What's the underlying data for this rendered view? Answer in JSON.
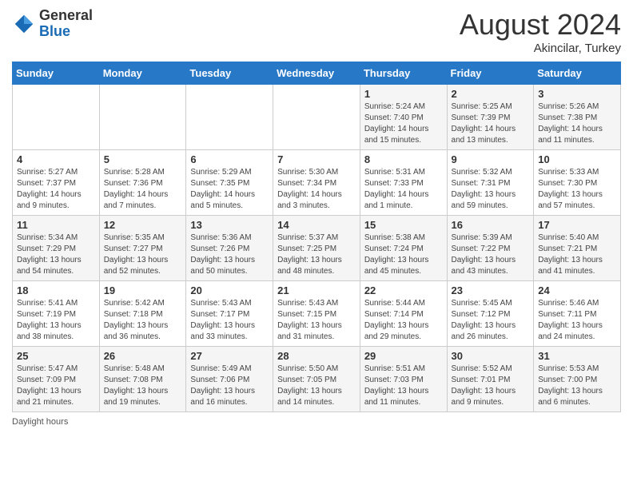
{
  "header": {
    "logo_general": "General",
    "logo_blue": "Blue",
    "month_year": "August 2024",
    "location": "Akincilar, Turkey"
  },
  "footer": {
    "daylight_label": "Daylight hours"
  },
  "days_of_week": [
    "Sunday",
    "Monday",
    "Tuesday",
    "Wednesday",
    "Thursday",
    "Friday",
    "Saturday"
  ],
  "weeks": [
    [
      {
        "day": "",
        "info": ""
      },
      {
        "day": "",
        "info": ""
      },
      {
        "day": "",
        "info": ""
      },
      {
        "day": "",
        "info": ""
      },
      {
        "day": "1",
        "info": "Sunrise: 5:24 AM\nSunset: 7:40 PM\nDaylight: 14 hours\nand 15 minutes."
      },
      {
        "day": "2",
        "info": "Sunrise: 5:25 AM\nSunset: 7:39 PM\nDaylight: 14 hours\nand 13 minutes."
      },
      {
        "day": "3",
        "info": "Sunrise: 5:26 AM\nSunset: 7:38 PM\nDaylight: 14 hours\nand 11 minutes."
      }
    ],
    [
      {
        "day": "4",
        "info": "Sunrise: 5:27 AM\nSunset: 7:37 PM\nDaylight: 14 hours\nand 9 minutes."
      },
      {
        "day": "5",
        "info": "Sunrise: 5:28 AM\nSunset: 7:36 PM\nDaylight: 14 hours\nand 7 minutes."
      },
      {
        "day": "6",
        "info": "Sunrise: 5:29 AM\nSunset: 7:35 PM\nDaylight: 14 hours\nand 5 minutes."
      },
      {
        "day": "7",
        "info": "Sunrise: 5:30 AM\nSunset: 7:34 PM\nDaylight: 14 hours\nand 3 minutes."
      },
      {
        "day": "8",
        "info": "Sunrise: 5:31 AM\nSunset: 7:33 PM\nDaylight: 14 hours\nand 1 minute."
      },
      {
        "day": "9",
        "info": "Sunrise: 5:32 AM\nSunset: 7:31 PM\nDaylight: 13 hours\nand 59 minutes."
      },
      {
        "day": "10",
        "info": "Sunrise: 5:33 AM\nSunset: 7:30 PM\nDaylight: 13 hours\nand 57 minutes."
      }
    ],
    [
      {
        "day": "11",
        "info": "Sunrise: 5:34 AM\nSunset: 7:29 PM\nDaylight: 13 hours\nand 54 minutes."
      },
      {
        "day": "12",
        "info": "Sunrise: 5:35 AM\nSunset: 7:27 PM\nDaylight: 13 hours\nand 52 minutes."
      },
      {
        "day": "13",
        "info": "Sunrise: 5:36 AM\nSunset: 7:26 PM\nDaylight: 13 hours\nand 50 minutes."
      },
      {
        "day": "14",
        "info": "Sunrise: 5:37 AM\nSunset: 7:25 PM\nDaylight: 13 hours\nand 48 minutes."
      },
      {
        "day": "15",
        "info": "Sunrise: 5:38 AM\nSunset: 7:24 PM\nDaylight: 13 hours\nand 45 minutes."
      },
      {
        "day": "16",
        "info": "Sunrise: 5:39 AM\nSunset: 7:22 PM\nDaylight: 13 hours\nand 43 minutes."
      },
      {
        "day": "17",
        "info": "Sunrise: 5:40 AM\nSunset: 7:21 PM\nDaylight: 13 hours\nand 41 minutes."
      }
    ],
    [
      {
        "day": "18",
        "info": "Sunrise: 5:41 AM\nSunset: 7:19 PM\nDaylight: 13 hours\nand 38 minutes."
      },
      {
        "day": "19",
        "info": "Sunrise: 5:42 AM\nSunset: 7:18 PM\nDaylight: 13 hours\nand 36 minutes."
      },
      {
        "day": "20",
        "info": "Sunrise: 5:43 AM\nSunset: 7:17 PM\nDaylight: 13 hours\nand 33 minutes."
      },
      {
        "day": "21",
        "info": "Sunrise: 5:43 AM\nSunset: 7:15 PM\nDaylight: 13 hours\nand 31 minutes."
      },
      {
        "day": "22",
        "info": "Sunrise: 5:44 AM\nSunset: 7:14 PM\nDaylight: 13 hours\nand 29 minutes."
      },
      {
        "day": "23",
        "info": "Sunrise: 5:45 AM\nSunset: 7:12 PM\nDaylight: 13 hours\nand 26 minutes."
      },
      {
        "day": "24",
        "info": "Sunrise: 5:46 AM\nSunset: 7:11 PM\nDaylight: 13 hours\nand 24 minutes."
      }
    ],
    [
      {
        "day": "25",
        "info": "Sunrise: 5:47 AM\nSunset: 7:09 PM\nDaylight: 13 hours\nand 21 minutes."
      },
      {
        "day": "26",
        "info": "Sunrise: 5:48 AM\nSunset: 7:08 PM\nDaylight: 13 hours\nand 19 minutes."
      },
      {
        "day": "27",
        "info": "Sunrise: 5:49 AM\nSunset: 7:06 PM\nDaylight: 13 hours\nand 16 minutes."
      },
      {
        "day": "28",
        "info": "Sunrise: 5:50 AM\nSunset: 7:05 PM\nDaylight: 13 hours\nand 14 minutes."
      },
      {
        "day": "29",
        "info": "Sunrise: 5:51 AM\nSunset: 7:03 PM\nDaylight: 13 hours\nand 11 minutes."
      },
      {
        "day": "30",
        "info": "Sunrise: 5:52 AM\nSunset: 7:01 PM\nDaylight: 13 hours\nand 9 minutes."
      },
      {
        "day": "31",
        "info": "Sunrise: 5:53 AM\nSunset: 7:00 PM\nDaylight: 13 hours\nand 6 minutes."
      }
    ]
  ]
}
